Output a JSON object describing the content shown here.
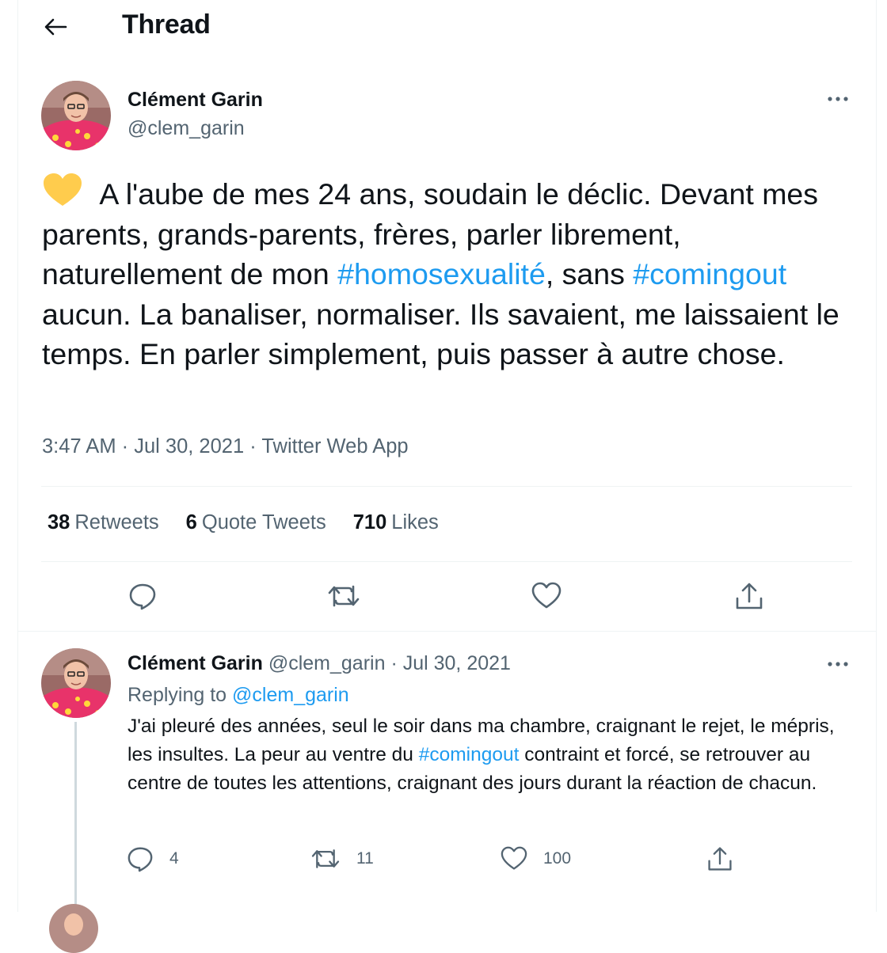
{
  "header": {
    "title": "Thread"
  },
  "main_tweet": {
    "author_name": "Clément Garin",
    "author_handle": "@clem_garin",
    "emoji": "yellow-heart",
    "text_parts": {
      "p1": " A l'aube de mes 24 ans, soudain le déclic. Devant mes parents, grands-parents, frères, parler librement, naturellement de mon ",
      "tag1": "#homosexualité",
      "p2": ", sans ",
      "tag2": "#comingout",
      "p3": " aucun. La banaliser, normaliser. Ils savaient, me laissaient le temps. En parler simplement, puis passer à autre chose."
    },
    "meta": "3:47 AM · Jul 30, 2021 · Twitter Web App",
    "stats": {
      "retweets_count": "38",
      "retweets_label": "Retweets",
      "quotes_count": "6",
      "quotes_label": "Quote Tweets",
      "likes_count": "710",
      "likes_label": "Likes"
    }
  },
  "reply_tweet": {
    "author_name": "Clément Garin",
    "author_handle": "@clem_garin",
    "separator": "·",
    "date": "Jul 30, 2021",
    "replying_label": "Replying to",
    "replying_mention": "@clem_garin",
    "text_parts": {
      "p1": "J'ai pleuré des années, seul le soir dans ma chambre, craignant le rejet, le mépris, les insultes. La peur au ventre du ",
      "tag1": "#comingout",
      "p2": " contraint et forcé, se retrouver au centre de toutes les attentions, craignant des jours durant la réaction de chacun."
    },
    "reply_count": "4",
    "retweet_count": "11",
    "like_count": "100"
  },
  "colors": {
    "text": "#0f1419",
    "secondary": "#536471",
    "link": "#1d9bf0",
    "divider": "#eff3f4",
    "thread_line": "#cfd9de",
    "emoji_heart": "#ffcc4d"
  }
}
